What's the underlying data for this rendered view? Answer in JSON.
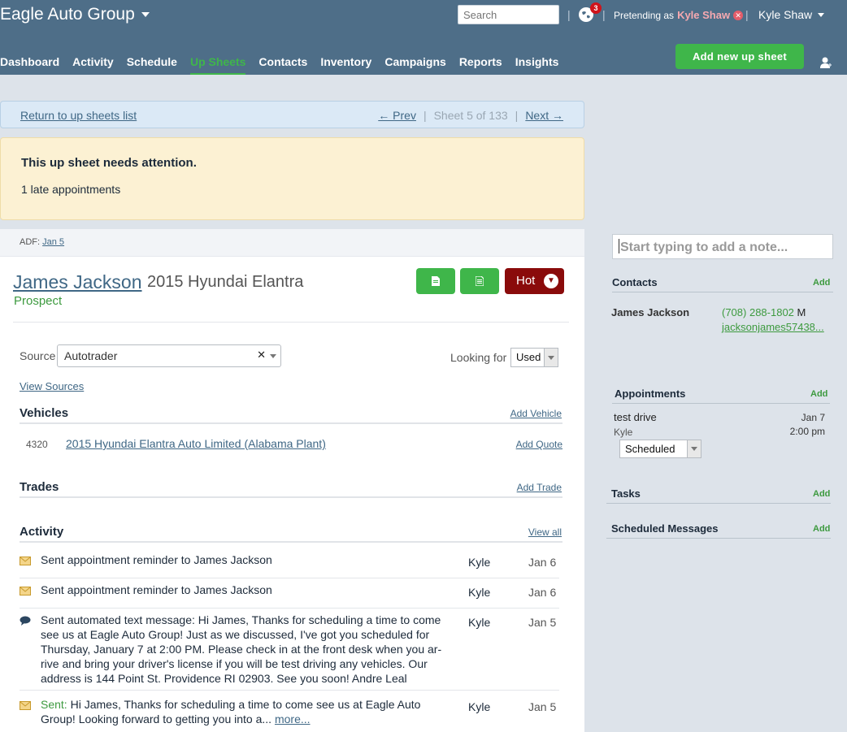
{
  "header": {
    "brand": "Eagle Auto Group",
    "search_placeholder": "Search",
    "notification_count": "3",
    "pretending_label": "Pretending as",
    "pretending_name": "Kyle Shaw",
    "user_name": "Kyle Shaw",
    "nav": [
      "Dashboard",
      "Activity",
      "Schedule",
      "Up Sheets",
      "Contacts",
      "Inventory",
      "Campaigns",
      "Reports",
      "Insights"
    ],
    "active_nav": "Up Sheets",
    "add_button": "Add new up sheet"
  },
  "pager": {
    "return_label": "Return to up sheets list",
    "prev_label": "← Prev",
    "sheet_info": "Sheet 5 of 133",
    "next_label": "Next →"
  },
  "alert": {
    "title": "This up sheet needs attention.",
    "detail": "1 late appointments"
  },
  "sheet": {
    "adf_label": "ADF:",
    "adf_date": "Jan 5",
    "customer_name": "James Jackson",
    "vehicle": "2015 Hyundai Elantra",
    "status": "Prospect",
    "hot_label": "Hot",
    "source_label": "Source",
    "source_value": "Autotrader",
    "looking_label": "Looking for",
    "looking_value": "Used",
    "view_sources": "View Sources",
    "vehicles_title": "Vehicles",
    "add_vehicle": "Add Vehicle",
    "vehicle_stock": "4320",
    "vehicle_link": "2015 Hyundai Elantra Auto Limited (Alabama Plant)",
    "add_quote": "Add Quote",
    "trades_title": "Trades",
    "add_trade": "Add Trade",
    "activity_title": "Activity",
    "view_all": "View all"
  },
  "activity": [
    {
      "icon": "envelope-icon",
      "text": "Sent appointment reminder to James Jackson",
      "who": "Kyle",
      "when": "Jan 6"
    },
    {
      "icon": "envelope-icon",
      "text": "Sent appointment reminder to James Jackson",
      "who": "Kyle",
      "when": "Jan 6"
    },
    {
      "icon": "chat-bubble-icon",
      "text": "Sent automated text message: Hi James, Thanks for scheduling a time to come see us at Eagle Auto Group! Just as we discussed, I've got you scheduled for Thursday, January 7 at 2:00 PM. Please check in at the front desk when you ar-rive and bring your driver's license if you will be test driving any vehicles. Our address is 144 Point St. Providence RI 02903. See you soon! Andre Leal",
      "who": "Kyle",
      "when": "Jan 5"
    },
    {
      "icon": "envelope-icon",
      "prefix": "Sent:",
      "text": "Hi James, Thanks for scheduling a time to come see us at Eagle Auto Group! Looking forward to getting you into a...",
      "more": "more...",
      "who": "Kyle",
      "when": "Jan 5"
    }
  ],
  "sidebar": {
    "note_placeholder": "Start typing to add a note...",
    "contacts_title": "Contacts",
    "add": "Add",
    "contact_name": "James Jackson",
    "contact_phone": "(708) 288-1802",
    "contact_phone_type": "M",
    "contact_email": "jacksonjames57438...",
    "appointments_title": "Appointments",
    "appt_title": "test drive",
    "appt_who": "Kyle",
    "appt_date": "Jan 7",
    "appt_time": "2:00 pm",
    "appt_status": "Scheduled",
    "tasks_title": "Tasks",
    "messages_title": "Scheduled Messages"
  },
  "colors": {
    "header_bg": "#4e6e88",
    "accent_green": "#3fb64a",
    "hot_red": "#8a0b0b",
    "link_blue": "#3f6785"
  }
}
